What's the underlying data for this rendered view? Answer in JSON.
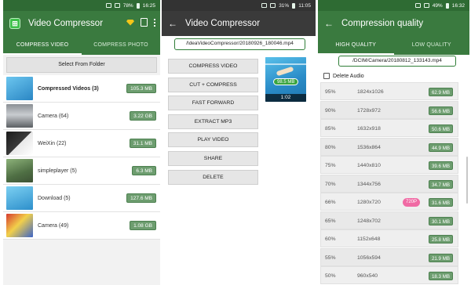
{
  "panel1": {
    "status": {
      "left": "",
      "battery": "78%",
      "time": "16:25"
    },
    "title": "Video Compressor",
    "tabs": [
      "COMPRESS VIDEO",
      "COMPRESS PHOTO"
    ],
    "select_button": "Select From Folder",
    "folders": [
      {
        "name": "Compressed Videos (3)",
        "size": "105.3 MB",
        "bold": true
      },
      {
        "name": "Camera (64)",
        "size": "3.22 GB"
      },
      {
        "name": "WeiXin (22)",
        "size": "31.1 MB"
      },
      {
        "name": "simpleplayer (5)",
        "size": "6.3 MB"
      },
      {
        "name": "Download (5)",
        "size": "127.6 MB"
      },
      {
        "name": "Camera (49)",
        "size": "1.08 GB"
      }
    ]
  },
  "panel2": {
    "status": {
      "battery": "31%",
      "time": "11:05"
    },
    "title": "Video Compressor",
    "path": "/IdeaVideoCompressor/20180926_180046.mp4",
    "actions": [
      "COMPRESS VIDEO",
      "CUT + COMPRESS",
      "FAST FORWARD",
      "EXTRACT MP3",
      "PLAY VIDEO",
      "SHARE",
      "DELETE"
    ],
    "preview": {
      "size": "98.5 MB",
      "duration": "1:02"
    }
  },
  "panel3": {
    "status": {
      "battery": "49%",
      "time": "16:32"
    },
    "title": "Compression quality",
    "tabs": [
      "HIGH QUALITY",
      "LOW QUALITY"
    ],
    "path": "/DCIM/Camera/20180812_133143.mp4",
    "delete_audio": "Delete Audio",
    "rows": [
      {
        "pct": "95%",
        "res": "1824x1026",
        "size": "62.9 MB"
      },
      {
        "pct": "90%",
        "res": "1728x972",
        "size": "56.6 MB"
      },
      {
        "pct": "85%",
        "res": "1632x918",
        "size": "50.6 MB"
      },
      {
        "pct": "80%",
        "res": "1536x864",
        "size": "44.9 MB"
      },
      {
        "pct": "75%",
        "res": "1440x810",
        "size": "39.6 MB"
      },
      {
        "pct": "70%",
        "res": "1344x756",
        "size": "34.7 MB"
      },
      {
        "pct": "66%",
        "res": "1280x720",
        "size": "31.6 MB",
        "badge": "720P"
      },
      {
        "pct": "65%",
        "res": "1248x702",
        "size": "30.1 MB"
      },
      {
        "pct": "60%",
        "res": "1152x648",
        "size": "25.8 MB"
      },
      {
        "pct": "55%",
        "res": "1056x594",
        "size": "21.9 MB"
      },
      {
        "pct": "50%",
        "res": "960x540",
        "size": "18.3 MB"
      }
    ]
  },
  "colors": {
    "green_primary": "#3a7a3f",
    "size_badge": "#6d9d6f",
    "dark_appbar": "#3a3a3a",
    "badge_pink": "#f06aa4"
  },
  "icons": [
    "app-logo-icon",
    "gem-icon",
    "document-icon",
    "overflow-menu-icon",
    "back-arrow-icon",
    "checkbox-icon"
  ]
}
